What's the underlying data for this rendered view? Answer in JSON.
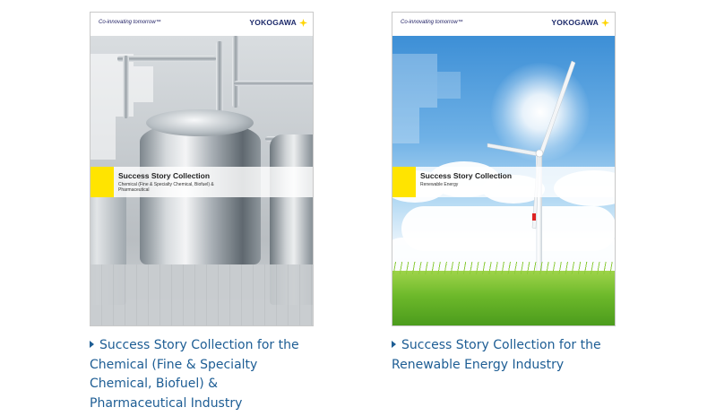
{
  "cards": [
    {
      "tagline": "Co-innovating tomorrow™",
      "logo": "YOKOGAWA",
      "banner_title": "Success Story Collection",
      "banner_subtitle": "Chemical (Fine & Specialty Chemical, Biofuel) & Pharmaceutical",
      "link_text": "Success Story Collection for the Chemical (Fine & Specialty Chemical, Biofuel) & Pharmaceutical Industry",
      "icon": "triangle-right-icon"
    },
    {
      "tagline": "Co-innovating tomorrow™",
      "logo": "YOKOGAWA",
      "banner_title": "Success Story Collection",
      "banner_subtitle": "Renewable Energy",
      "link_text": "Success Story Collection for the Renewable Energy Industry",
      "icon": "triangle-right-icon"
    }
  ],
  "colors": {
    "link": "#1d5d94",
    "accent_yellow": "#ffe400",
    "logo_blue": "#1d2a6b"
  }
}
